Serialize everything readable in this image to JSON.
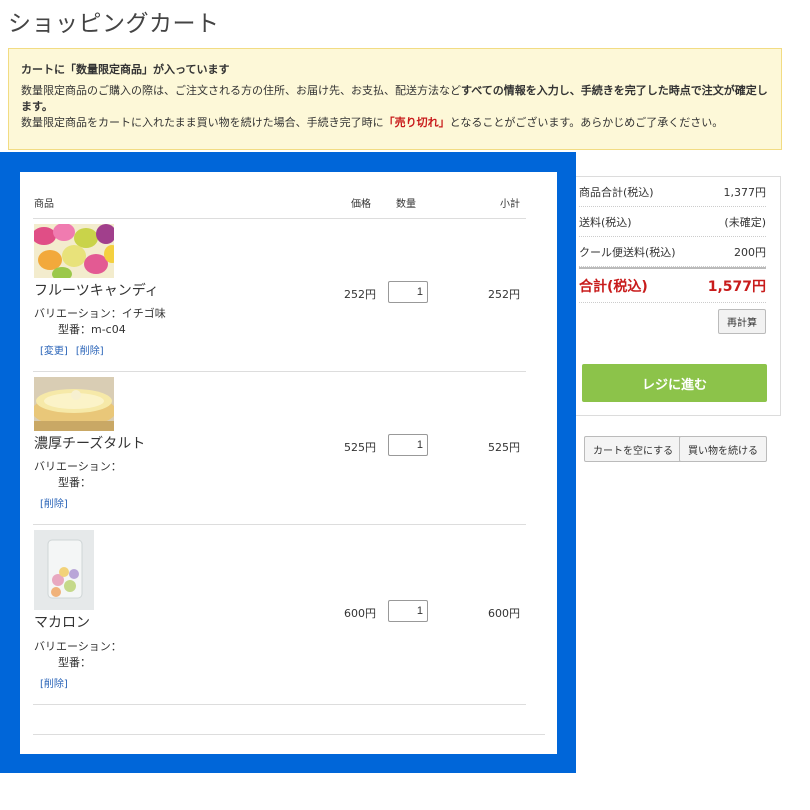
{
  "page": {
    "title": "ショッピングカート"
  },
  "notice": {
    "title": "カートに「数量限定商品」が入っています",
    "line1_a": "数量限定商品のご購入の際は、ご注文される方の住所、お届け先、お支払、配送方法など",
    "line1_b": "すべての情報を入力し、手続きを完了した時点で注文が確定します。",
    "line2_a": "数量限定商品をカートに入れたまま買い物を続けた場合、手続き完了時に",
    "line2_red": "「売り切れ」",
    "line2_b": "となることがございます。あらかじめご了承ください。"
  },
  "cart": {
    "headers": {
      "product": "商品",
      "price": "価格",
      "qty": "数量",
      "subtotal": "小計"
    },
    "items": [
      {
        "name": "フルーツキャンディ",
        "variation_label": "バリエーション：",
        "variation": "イチゴ味",
        "sku_label": "型番：",
        "sku": "m-c04",
        "price": "252円",
        "qty": "1",
        "subtotal": "252円",
        "change_link": "[変更]",
        "delete_link": "[削除]"
      },
      {
        "name": "濃厚チーズタルト",
        "variation_label": "バリエーション：",
        "variation": "",
        "sku_label": "型番：",
        "sku": "",
        "price": "525円",
        "qty": "1",
        "subtotal": "525円",
        "delete_link": "[削除]"
      },
      {
        "name": "マカロン",
        "variation_label": "バリエーション：",
        "variation": "",
        "sku_label": "型番：",
        "sku": "",
        "price": "600円",
        "qty": "1",
        "subtotal": "600円",
        "delete_link": "[削除]"
      }
    ]
  },
  "summary": {
    "rows": [
      {
        "label": "商品合計(税込)",
        "value": "1,377円"
      },
      {
        "label": "送料(税込)",
        "value": "(未確定)"
      },
      {
        "label": "クール便送料(税込)",
        "value": "200円"
      }
    ],
    "total_label": "合計(税込)",
    "total_value": "1,577円",
    "recalc": "再計算",
    "checkout": "レジに進む"
  },
  "actions": {
    "empty_cart": "カートを空にする",
    "continue_shopping": "買い物を続ける"
  },
  "colors": {
    "overlay": "#0066d9",
    "checkout": "#8cc34a",
    "total": "#c81b1b",
    "link": "#2a64b8"
  }
}
